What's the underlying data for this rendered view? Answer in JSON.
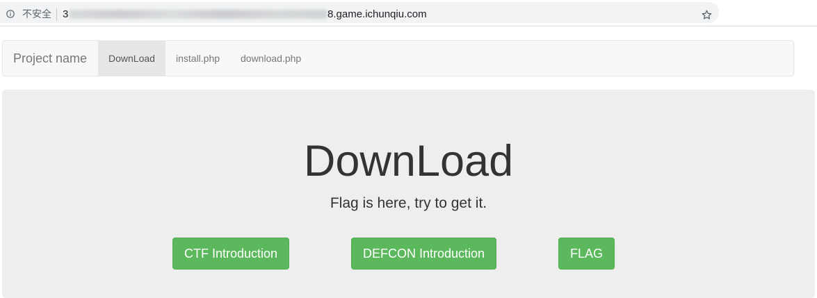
{
  "browser": {
    "security_label": "不安全",
    "url_prefix": "3",
    "url_suffix": "8.game.ichunqiu.com",
    "icons": [
      "info-icon",
      "star-icon"
    ]
  },
  "navbar": {
    "brand": "Project name",
    "items": [
      {
        "label": "DownLoad",
        "active": true
      },
      {
        "label": "install.php",
        "active": false
      },
      {
        "label": "download.php",
        "active": false
      }
    ]
  },
  "jumbotron": {
    "title": "DownLoad",
    "lead": "Flag is here, try to get it.",
    "buttons": [
      {
        "label": "CTF Introduction"
      },
      {
        "label": "DEFCON Introduction"
      },
      {
        "label": "FLAG"
      }
    ]
  },
  "colors": {
    "button_green": "#5cb85c",
    "jumbotron_bg": "#eeeeee",
    "navbar_bg": "#f8f8f8",
    "nav_active_bg": "#e7e7e7"
  }
}
